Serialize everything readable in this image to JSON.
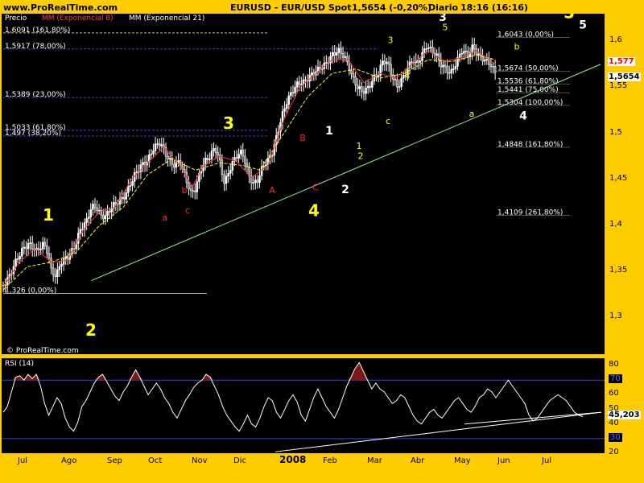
{
  "header": {
    "site": "www.ProRealTime.com",
    "symbol": "EURUSD - EUR/USD Spot",
    "quote": "1,5654 (-0,20%)",
    "period": "Diario",
    "time": "18:16 (16:16)"
  },
  "legend": {
    "price_label": "Precio",
    "ma8": "MM (Exponencial 8)",
    "ma21": "MM (Exponencial 21)"
  },
  "copyright": "© ProRealTime.com",
  "colors": {
    "background": "#FFCC00",
    "panel": "#000000",
    "candles": "#FFFFFF",
    "ma8": "#FF3030",
    "ma21": "#FFFF00",
    "trendline": "#90EE90",
    "fib": "#4040FF",
    "wave": "#FFFF00"
  },
  "chart_data": [
    {
      "type": "candlestick",
      "name": "EURUSD",
      "ylim": [
        1.26,
        1.63
      ],
      "y_ticks": [
        "1,6",
        "1,55",
        "1,5",
        "1,45",
        "1,4",
        "1,35",
        "1,3"
      ],
      "x_ticks": [
        "Jul",
        "Ago",
        "Sep",
        "Oct",
        "Nov",
        "Dic",
        "2008",
        "Feb",
        "Mar",
        "Abr",
        "May",
        "Jun",
        "Jul"
      ],
      "last_price_labels": [
        "1,577",
        "1,5654"
      ],
      "close_path": [
        [
          0,
          1.335
        ],
        [
          8,
          1.345
        ],
        [
          15,
          1.36
        ],
        [
          25,
          1.375
        ],
        [
          32,
          1.38
        ],
        [
          42,
          1.372
        ],
        [
          50,
          1.38
        ],
        [
          56,
          1.37
        ],
        [
          60,
          1.35
        ],
        [
          66,
          1.345
        ],
        [
          72,
          1.36
        ],
        [
          80,
          1.365
        ],
        [
          88,
          1.375
        ],
        [
          96,
          1.395
        ],
        [
          104,
          1.405
        ],
        [
          110,
          1.42
        ],
        [
          116,
          1.42
        ],
        [
          122,
          1.41
        ],
        [
          128,
          1.41
        ],
        [
          135,
          1.42
        ],
        [
          142,
          1.425
        ],
        [
          150,
          1.43
        ],
        [
          156,
          1.44
        ],
        [
          164,
          1.455
        ],
        [
          172,
          1.465
        ],
        [
          180,
          1.47
        ],
        [
          188,
          1.485
        ],
        [
          196,
          1.49
        ],
        [
          204,
          1.475
        ],
        [
          212,
          1.465
        ],
        [
          220,
          1.47
        ],
        [
          228,
          1.45
        ],
        [
          234,
          1.435
        ],
        [
          240,
          1.44
        ],
        [
          246,
          1.46
        ],
        [
          252,
          1.47
        ],
        [
          258,
          1.475
        ],
        [
          264,
          1.485
        ],
        [
          270,
          1.47
        ],
        [
          276,
          1.445
        ],
        [
          282,
          1.46
        ],
        [
          290,
          1.475
        ],
        [
          298,
          1.48
        ],
        [
          306,
          1.455
        ],
        [
          312,
          1.445
        ],
        [
          318,
          1.45
        ],
        [
          324,
          1.465
        ],
        [
          330,
          1.47
        ],
        [
          336,
          1.48
        ],
        [
          342,
          1.5
        ],
        [
          348,
          1.52
        ],
        [
          354,
          1.535
        ],
        [
          360,
          1.545
        ],
        [
          368,
          1.555
        ],
        [
          374,
          1.555
        ],
        [
          380,
          1.56
        ],
        [
          386,
          1.565
        ],
        [
          394,
          1.57
        ],
        [
          402,
          1.575
        ],
        [
          410,
          1.585
        ],
        [
          418,
          1.59
        ],
        [
          424,
          1.585
        ],
        [
          430,
          1.575
        ],
        [
          436,
          1.56
        ],
        [
          442,
          1.55
        ],
        [
          448,
          1.545
        ],
        [
          456,
          1.55
        ],
        [
          462,
          1.56
        ],
        [
          468,
          1.565
        ],
        [
          474,
          1.58
        ],
        [
          480,
          1.575
        ],
        [
          486,
          1.56
        ],
        [
          492,
          1.55
        ],
        [
          498,
          1.56
        ],
        [
          504,
          1.57
        ],
        [
          510,
          1.58
        ],
        [
          516,
          1.575
        ],
        [
          522,
          1.585
        ],
        [
          528,
          1.595
        ],
        [
          534,
          1.59
        ],
        [
          540,
          1.585
        ],
        [
          546,
          1.575
        ],
        [
          552,
          1.57
        ],
        [
          558,
          1.565
        ],
        [
          564,
          1.575
        ],
        [
          572,
          1.59
        ],
        [
          580,
          1.585
        ],
        [
          586,
          1.595
        ],
        [
          592,
          1.585
        ],
        [
          600,
          1.58
        ],
        [
          608,
          1.575
        ],
        [
          614,
          1.565
        ]
      ],
      "ema8_path": [
        [
          0,
          1.333
        ],
        [
          20,
          1.36
        ],
        [
          40,
          1.375
        ],
        [
          60,
          1.36
        ],
        [
          80,
          1.362
        ],
        [
          100,
          1.395
        ],
        [
          120,
          1.415
        ],
        [
          140,
          1.42
        ],
        [
          160,
          1.45
        ],
        [
          180,
          1.468
        ],
        [
          200,
          1.485
        ],
        [
          220,
          1.465
        ],
        [
          236,
          1.442
        ],
        [
          250,
          1.465
        ],
        [
          270,
          1.475
        ],
        [
          290,
          1.47
        ],
        [
          310,
          1.452
        ],
        [
          330,
          1.465
        ],
        [
          350,
          1.515
        ],
        [
          370,
          1.55
        ],
        [
          390,
          1.565
        ],
        [
          410,
          1.58
        ],
        [
          430,
          1.58
        ],
        [
          450,
          1.555
        ],
        [
          470,
          1.565
        ],
        [
          490,
          1.56
        ],
        [
          510,
          1.575
        ],
        [
          530,
          1.59
        ],
        [
          550,
          1.578
        ],
        [
          570,
          1.582
        ],
        [
          590,
          1.59
        ],
        [
          614,
          1.575
        ]
      ],
      "ema21_path": [
        [
          0,
          1.33
        ],
        [
          30,
          1.355
        ],
        [
          60,
          1.36
        ],
        [
          90,
          1.37
        ],
        [
          120,
          1.4
        ],
        [
          150,
          1.42
        ],
        [
          180,
          1.455
        ],
        [
          210,
          1.472
        ],
        [
          240,
          1.46
        ],
        [
          270,
          1.468
        ],
        [
          300,
          1.465
        ],
        [
          320,
          1.46
        ],
        [
          350,
          1.5
        ],
        [
          380,
          1.54
        ],
        [
          410,
          1.565
        ],
        [
          440,
          1.57
        ],
        [
          470,
          1.56
        ],
        [
          500,
          1.565
        ],
        [
          530,
          1.58
        ],
        [
          560,
          1.578
        ],
        [
          590,
          1.585
        ],
        [
          614,
          1.58
        ]
      ],
      "trendline": [
        [
          110,
          1.34
        ],
        [
          745,
          1.575
        ]
      ],
      "fib_levels": [
        {
          "label": "1,6091 (161,80%)",
          "value": 1.6091
        },
        {
          "label": "1,5917 (78,00%)",
          "value": 1.5917
        },
        {
          "label": "1,5389 (23,00%)",
          "value": 1.5389
        },
        {
          "label": "1,5033 (61,80%)",
          "value": 1.5033
        },
        {
          "label": "1,497 (38,20%)",
          "value": 1.497
        },
        {
          "label": "1,326 (0,00%)",
          "value": 1.326
        },
        {
          "label": "1,6043 (0,00%)",
          "value": 1.6043
        },
        {
          "label": "1,5674 (50,00%)",
          "value": 1.5674
        },
        {
          "label": "1,5536 (61,80%)",
          "value": 1.5536
        },
        {
          "label": "1,5441 (75,00%)",
          "value": 1.5441
        },
        {
          "label": "1,5304 (100,00%)",
          "value": 1.5304
        },
        {
          "label": "1,4848 (161,80%)",
          "value": 1.4848
        },
        {
          "label": "1,4109 (261,80%)",
          "value": 1.4109
        }
      ],
      "wave_labels": [
        {
          "text": "1",
          "size": "large",
          "color": "yellow"
        },
        {
          "text": "2",
          "size": "large",
          "color": "yellow"
        },
        {
          "text": "3",
          "size": "large",
          "color": "yellow"
        },
        {
          "text": "4",
          "size": "large",
          "color": "yellow"
        },
        {
          "text": "5",
          "size": "large",
          "color": "yellow"
        },
        {
          "text": "1",
          "size": "medium",
          "color": "white"
        },
        {
          "text": "2",
          "size": "medium",
          "color": "white"
        },
        {
          "text": "3",
          "size": "medium",
          "color": "white"
        },
        {
          "text": "4",
          "size": "medium",
          "color": "white"
        },
        {
          "text": "5",
          "size": "medium",
          "color": "white"
        },
        {
          "text": "a",
          "size": "small",
          "color": "red"
        },
        {
          "text": "b",
          "size": "small",
          "color": "red"
        },
        {
          "text": "c",
          "size": "small",
          "color": "red"
        },
        {
          "text": "A",
          "size": "small",
          "color": "red"
        },
        {
          "text": "B",
          "size": "small",
          "color": "red"
        },
        {
          "text": "C",
          "size": "small",
          "color": "red"
        },
        {
          "text": "3",
          "size": "small",
          "color": "yellow"
        },
        {
          "text": "4",
          "size": "small",
          "color": "yellow"
        },
        {
          "text": "5",
          "size": "small",
          "color": "yellow"
        },
        {
          "text": "a",
          "size": "small",
          "color": "yellow"
        },
        {
          "text": "b",
          "size": "small",
          "color": "yellow"
        },
        {
          "text": "c",
          "size": "small",
          "color": "yellow"
        },
        {
          "text": "1",
          "size": "small",
          "color": "yellow"
        },
        {
          "text": "2",
          "size": "small",
          "color": "yellow"
        }
      ]
    },
    {
      "type": "line",
      "name": "RSI (14)",
      "ylim": [
        20,
        85
      ],
      "y_ticks": [
        "80",
        "70",
        "60",
        "50",
        "40",
        "30",
        "20"
      ],
      "levels": [
        70,
        30
      ],
      "level_labels": [
        "70",
        "30"
      ],
      "last_value_label": "45,203",
      "values": [
        48,
        52,
        62,
        72,
        73,
        70,
        74,
        71,
        74,
        66,
        54,
        46,
        52,
        58,
        54,
        44,
        38,
        35,
        41,
        52,
        56,
        62,
        68,
        72,
        74,
        69,
        64,
        59,
        56,
        62,
        66,
        72,
        77,
        72,
        66,
        60,
        64,
        68,
        64,
        58,
        54,
        48,
        44,
        50,
        56,
        60,
        65,
        68,
        70,
        74,
        72,
        66,
        60,
        52,
        46,
        42,
        38,
        35,
        40,
        46,
        40,
        38,
        44,
        52,
        58,
        56,
        48,
        44,
        50,
        56,
        60,
        55,
        46,
        42,
        50,
        58,
        64,
        58,
        52,
        48,
        44,
        50,
        58,
        66,
        72,
        78,
        82,
        76,
        70,
        64,
        68,
        64,
        62,
        58,
        54,
        56,
        60,
        58,
        52,
        46,
        42,
        40,
        44,
        48,
        50,
        46,
        44,
        48,
        52,
        56,
        58,
        54,
        50,
        48,
        52,
        58,
        60,
        64,
        62,
        58,
        62,
        66,
        70,
        66,
        62,
        58,
        54,
        46,
        42,
        44,
        48,
        52,
        56,
        58,
        60,
        58,
        56,
        52,
        48,
        46,
        45
      ],
      "trendlines": [
        [
          [
            340,
            21
          ],
          [
            745,
            48
          ]
        ],
        [
          [
            575,
            40
          ],
          [
            745,
            48
          ]
        ]
      ]
    }
  ]
}
